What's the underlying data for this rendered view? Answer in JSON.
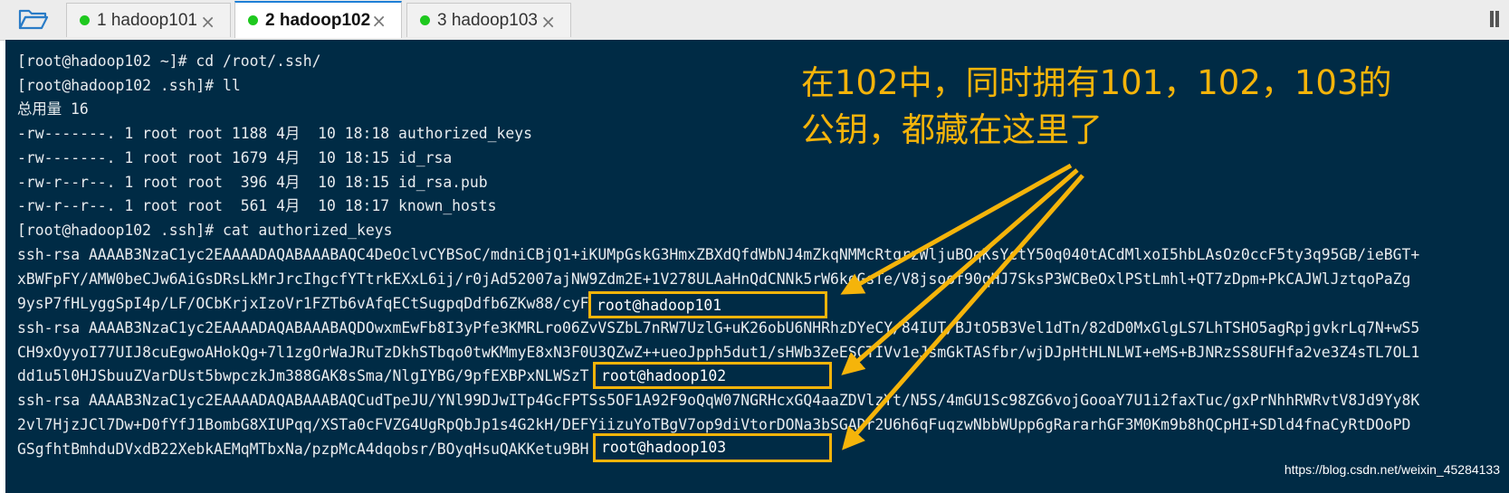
{
  "tabs": [
    {
      "label": "1 hadoop101"
    },
    {
      "label": "2 hadoop102"
    },
    {
      "label": "3 hadoop103"
    }
  ],
  "tab_close_glyph": "×",
  "colors": {
    "terminal_bg": "#002b45",
    "terminal_text": "#e8ecef",
    "annotation": "#f5b40a",
    "status_dot": "#1ec81e",
    "active_tab_accent": "#1e7fd6"
  },
  "terminal": {
    "lines": [
      "[root@hadoop102 ~]# cd /root/.ssh/",
      "[root@hadoop102 .ssh]# ll",
      "总用量 16",
      "-rw-------. 1 root root 1188 4月  10 18:18 authorized_keys",
      "-rw-------. 1 root root 1679 4月  10 18:15 id_rsa",
      "-rw-r--r--. 1 root root  396 4月  10 18:15 id_rsa.pub",
      "-rw-r--r--. 1 root root  561 4月  10 18:17 known_hosts",
      "[root@hadoop102 .ssh]# cat authorized_keys",
      "ssh-rsa AAAAB3NzaC1yc2EAAAADAQABAAABAQC4DeOclvCYBSoC/mdniCBjQ1+iKUMpGskG3HmxZBXdQfdWbNJ4mZkqNMMcRtqrzWljuBOqKsYctY50q040tACdMlxoI5hbLAsOz0ccF5ty3q95GB/ieBGT+",
      "xBWFpFY/AMW0beCJw6AiGsDRsLkMrJrcIhgcfYTtrkEXxL6ij/r0jAd52007ajNW9Zdm2E+1V278ULAaHnQdCNNk5rW6kqGsTe/V8jsoof90qHJ7SksP3WCBeOxlPStLmhl+QT7zDpm+PkCAJWlJztqoPaZg",
      "9ysP7fHLyggSpI4p/LF/OCbKrjxIzoVr1FZTb6vAfqECtSugpqDdfb6ZKw88/cyF",
      "ssh-rsa AAAAB3NzaC1yc2EAAAADAQABAAABAQDOwxmEwFb8I3yPfe3KMRLro06ZvVSZbL7nRW7UzlG+uK26obU6NHRhzDYeCY/84IUT/BJtO5B3Vel1dTn/82dD0MxGlgLS7LhTSHO5agRpjgvkrLq7N+wS5",
      "CH9xOyyoI77UIJ8cuEgwoAHokQg+7l1zgOrWaJRuTzDkhSTbqo0twKMmyE8xN3F0U3QZwZ++ueoJpph5dut1/sHWb3ZeESCTIVv1eJsmGkTASfbr/wjDJpHtHLNLWI+eMS+BJNRzSS8UFHfa2ve3Z4sTL7OL1",
      "dd1u5l0HJSbuuZVarDUst5bwpczkJm388GAK8sSma/NlgIYBG/9pfEXBPxNLWSzT",
      "ssh-rsa AAAAB3NzaC1yc2EAAAADAQABAAABAQCudTpeJU/YNl99DJwITp4GcFPTSs5OF1A92F9oQqW07NGRHcxGQ4aaZDVlzYt/N5S/4mGU1Sc98ZG6vojGooaY7U1i2faxTuc/gxPrNhhRWRvtV8Jd9Yy8K",
      "2vl7HjzJCl7Dw+D0fYfJ1BombG8XIUPqq/XSTa0cFVZG4UgRpQbJp1s4G2kH/DEFYiizuYoTBgV7op9diVtorDONa3bSGADr2U6h6qFuqzwNbbWUpp6gRararhGF3M0Km9b8hQCpHI+SDld4fnaCyRtDOoPD",
      "GSgfhtBmhduDVxdB22XebkAEMqMTbxNa/pzpMcA4dqobsr/BOyqHsuQAKKetu9BH"
    ],
    "key_owners": [
      "root@hadoop101",
      "root@hadoop102",
      "root@hadoop103"
    ]
  },
  "annotation": {
    "line1": "在102中，同时拥有101，102，103的",
    "line2": "公钥，都藏在这里了"
  },
  "watermark": "https://blog.csdn.net/weixin_45284133"
}
